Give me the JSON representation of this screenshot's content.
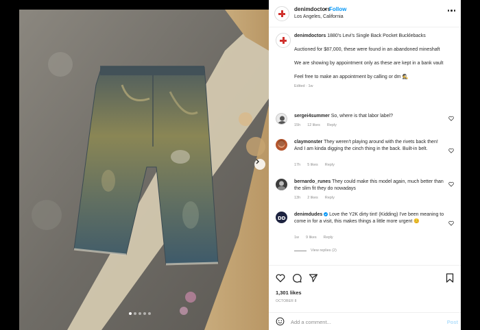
{
  "post": {
    "username": "denimdoctors",
    "separator": "•",
    "follow_label": "Follow",
    "location": "Los Angeles, California",
    "more_icon": "more-horizontal-icon"
  },
  "caption": {
    "username": "denimdoctors",
    "title": "1880's Levi's Single Back Pocket Bucklebacks",
    "p1": "Auctioned for $87,000, these were found in an abandoned mineshaft",
    "p2": "We are showing by appointment only as these are kept in a bank vault",
    "p3": "Feel free to make an appointment by calling or dm",
    "p3_emoji": "🕵",
    "meta": "Edited · 1w"
  },
  "comments": [
    {
      "username": "sergei4summer",
      "text": "So, where is that labor label?",
      "age": "15h",
      "likes": "12 likes",
      "reply": "Reply"
    },
    {
      "username": "claymonster",
      "text": "They weren't playing around with the rivets back then! And I am kinda digging the cinch thing in the back. Built-in belt.",
      "age": "17h",
      "likes": "5 likes",
      "reply": "Reply"
    },
    {
      "username": "bernardo_runes",
      "text": "They could make this model again, much better than the slim fit they do nowadays",
      "age": "13h",
      "likes": "2 likes",
      "reply": "Reply"
    },
    {
      "username": "denimdudes",
      "text": "Love the Y2K dirty tint! (Kidding) I've been meaning to come in for a visit, this makes things a little more urgent",
      "emoji": "😊",
      "age": "1w",
      "likes": "9 likes",
      "reply": "Reply",
      "view_replies": "View replies (2)"
    }
  ],
  "actions": {
    "likes": "1,301 likes",
    "date": "OCTOBER 8",
    "add_comment_placeholder": "Add a comment...",
    "post_label": "Post"
  },
  "colors": {
    "accent": "#0095f6",
    "brand_red": "#d0312d"
  }
}
